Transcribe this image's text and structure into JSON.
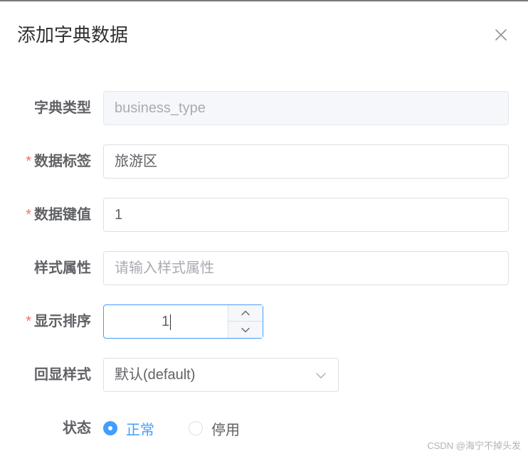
{
  "dialog": {
    "title": "添加字典数据"
  },
  "form": {
    "dict_type": {
      "label": "字典类型",
      "value": "business_type"
    },
    "dict_label": {
      "label": "数据标签",
      "value": "旅游区"
    },
    "dict_value": {
      "label": "数据键值",
      "value": "1"
    },
    "css_class": {
      "label": "样式属性",
      "placeholder": "请输入样式属性"
    },
    "sort": {
      "label": "显示排序",
      "value": "1"
    },
    "list_class": {
      "label": "回显样式",
      "selected": "默认(default)"
    },
    "status": {
      "label": "状态",
      "options": [
        {
          "label": "正常",
          "checked": true
        },
        {
          "label": "停用",
          "checked": false
        }
      ]
    },
    "required_mark": "*"
  },
  "watermark": "CSDN @海宁不掉头发",
  "colors": {
    "primary": "#409eff",
    "required": "#f56c6c",
    "border": "#dcdfe6",
    "disabled_bg": "#f5f7fa"
  },
  "icons": {
    "close": "close-icon",
    "up": "chevron-up-icon",
    "down": "chevron-down-icon",
    "select_arrow": "chevron-down-icon"
  }
}
